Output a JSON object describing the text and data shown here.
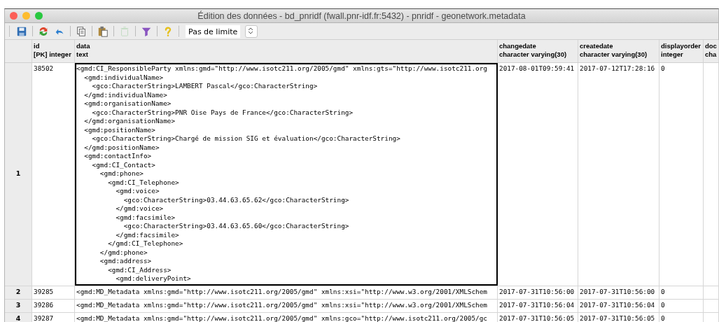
{
  "window": {
    "title": "Édition des données - bd_pnridf (fwall.pnr-idf.fr:5432) - pnridf - geonetwork.metadata"
  },
  "toolbar": {
    "items": [
      {
        "kind": "save",
        "disabled": false
      },
      {
        "kind": "separator"
      },
      {
        "kind": "refresh",
        "disabled": false
      },
      {
        "kind": "undo",
        "disabled": false
      },
      {
        "kind": "separator"
      },
      {
        "kind": "copy",
        "disabled": false
      },
      {
        "kind": "separator"
      },
      {
        "kind": "paste",
        "disabled": false
      },
      {
        "kind": "separator"
      },
      {
        "kind": "delete",
        "disabled": true
      },
      {
        "kind": "separator"
      },
      {
        "kind": "filter",
        "disabled": false
      },
      {
        "kind": "separator"
      },
      {
        "kind": "help",
        "disabled": false
      }
    ],
    "limit": {
      "value": "Pas de limite"
    }
  },
  "table": {
    "columns": [
      {
        "name": "id",
        "type": "[PK] integer"
      },
      {
        "name": "data",
        "type": "text"
      },
      {
        "name": "changedate",
        "type": "character varying(30)"
      },
      {
        "name": "createdate",
        "type": "character varying(30)"
      },
      {
        "name": "displayorder",
        "type": "integer"
      },
      {
        "name": "doc",
        "type": "cha"
      }
    ],
    "rows": [
      {
        "number": "1",
        "focused": true,
        "cells": [
          "38502",
          "<gmd:CI_ResponsibleParty xmlns:gmd=\"http://www.isotc211.org/2005/gmd\" xmlns:gts=\"http://www.isotc211.org\n  <gmd:individualName>\n    <gco:CharacterString>LAMBERT Pascal</gco:CharacterString>\n  </gmd:individualName>\n  <gmd:organisationName>\n    <gco:CharacterString>PNR Oise Pays de France</gco:CharacterString>\n  </gmd:organisationName>\n  <gmd:positionName>\n    <gco:CharacterString>Chargé de mission SIG et évaluation</gco:CharacterString>\n  </gmd:positionName>\n  <gmd:contactInfo>\n    <gmd:CI_Contact>\n      <gmd:phone>\n        <gmd:CI_Telephone>\n          <gmd:voice>\n            <gco:CharacterString>03.44.63.65.62</gco:CharacterString>\n          </gmd:voice>\n          <gmd:facsimile>\n            <gco:CharacterString>03.44.63.65.60</gco:CharacterString>\n          </gmd:facsimile>\n        </gmd:CI_Telephone>\n      </gmd:phone>\n      <gmd:address>\n        <gmd:CI_Address>\n          <gmd:deliveryPoint>",
          "2017-08-01T09:59:41",
          "2017-07-12T17:28:16",
          "0",
          ""
        ]
      },
      {
        "number": "2",
        "focused": false,
        "cells": [
          "39285",
          "<gmd:MD_Metadata xmlns:gmd=\"http://www.isotc211.org/2005/gmd\" xmlns:xsi=\"http://www.w3.org/2001/XMLSchem",
          "2017-07-31T10:56:00",
          "2017-07-31T10:56:00",
          "0",
          ""
        ]
      },
      {
        "number": "3",
        "focused": false,
        "cells": [
          "39286",
          "<gmd:MD_Metadata xmlns:gmd=\"http://www.isotc211.org/2005/gmd\" xmlns:xsi=\"http://www.w3.org/2001/XMLSchem",
          "2017-07-31T10:56:04",
          "2017-07-31T10:56:04",
          "0",
          ""
        ]
      },
      {
        "number": "4",
        "focused": false,
        "cells": [
          "39287",
          "<gmd:MD_Metadata xmlns:gmd=\"http://www.isotc211.org/2005/gmd\" xmlns:gco=\"http://www.isotc211.org/2005/gc",
          "2017-07-31T10:56:05",
          "2017-07-31T10:56:05",
          "0",
          ""
        ]
      }
    ]
  }
}
